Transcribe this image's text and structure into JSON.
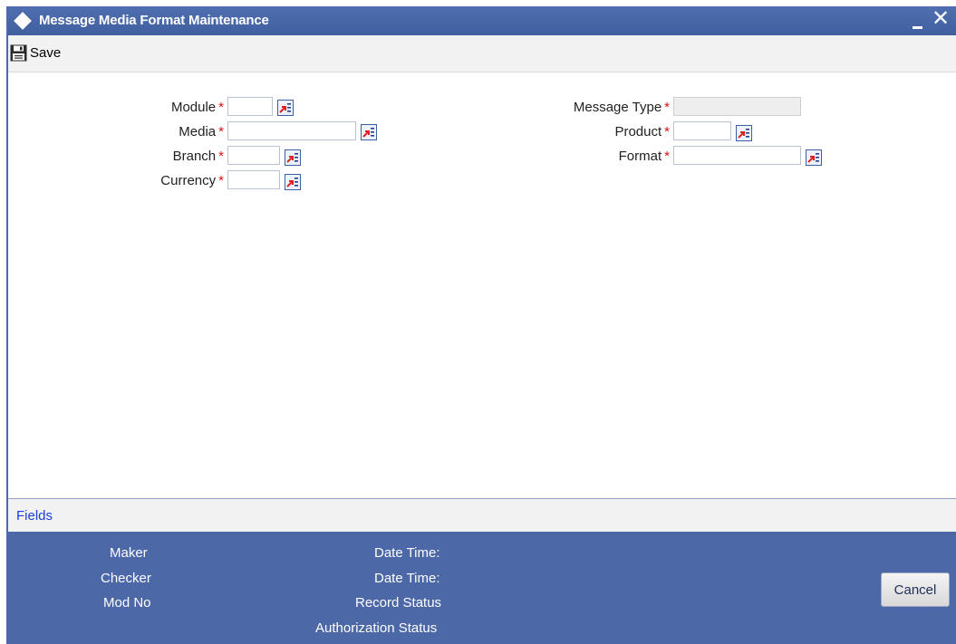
{
  "window": {
    "title": "Message Media Format Maintenance"
  },
  "toolbar": {
    "save_label": "Save"
  },
  "form": {
    "module": {
      "label": "Module",
      "value": ""
    },
    "media": {
      "label": "Media",
      "value": ""
    },
    "branch": {
      "label": "Branch",
      "value": ""
    },
    "currency": {
      "label": "Currency",
      "value": ""
    },
    "message_type": {
      "label": "Message Type",
      "value": ""
    },
    "product": {
      "label": "Product",
      "value": ""
    },
    "format": {
      "label": "Format",
      "value": ""
    },
    "required_marker": "*"
  },
  "fields_bar": {
    "link_label": "Fields"
  },
  "audit": {
    "maker": "Maker",
    "checker": "Checker",
    "mod_no": "Mod No",
    "date_time_1": "Date Time:",
    "date_time_2": "Date Time:",
    "record_status": "Record Status",
    "authorization_status": "Authorization Status",
    "cancel_label": "Cancel"
  },
  "icons": {
    "title": "diamond-icon",
    "save": "floppy-disk-icon",
    "lov": "list-of-values-icon",
    "minimize": "minimize-icon",
    "close": "close-icon"
  },
  "colors": {
    "titlebar": "#4469a9",
    "footer": "#4c68a6",
    "required": "#dd1111",
    "link": "#1a3fd6"
  }
}
